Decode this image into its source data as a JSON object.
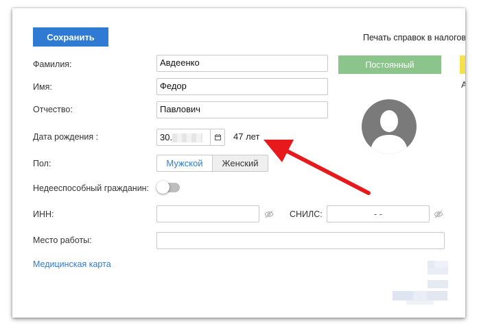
{
  "toolbar": {
    "save_label": "Сохранить",
    "print_label": "Печать справок в налоговую"
  },
  "status": {
    "label": "Постоянный",
    "cut_text": "А",
    "color": "#8bc58b"
  },
  "form": {
    "last_name": {
      "label": "Фамилия:",
      "value": "Авдеенко"
    },
    "first_name": {
      "label": "Имя:",
      "value": "Федор"
    },
    "patronymic": {
      "label": "Отчество:",
      "value": "Павлович"
    },
    "birth_date": {
      "label": "Дата рождения  :",
      "value_prefix": "30.",
      "age": "47 лет"
    },
    "gender": {
      "label": "Пол:",
      "options": [
        "Мужской",
        "Женский"
      ],
      "selected": "Мужской"
    },
    "incapable": {
      "label": "Недееспособный гражданин:",
      "on": false
    },
    "inn": {
      "label": "ИНН:",
      "value": ""
    },
    "snils": {
      "label": "СНИЛС:",
      "value": "-  -"
    },
    "workplace": {
      "label": "Место работы:",
      "value": ""
    }
  },
  "links": {
    "medical_card": "Медицинская карта"
  },
  "colors": {
    "accent": "#2f7bd3",
    "arrow": "#e8191c"
  }
}
